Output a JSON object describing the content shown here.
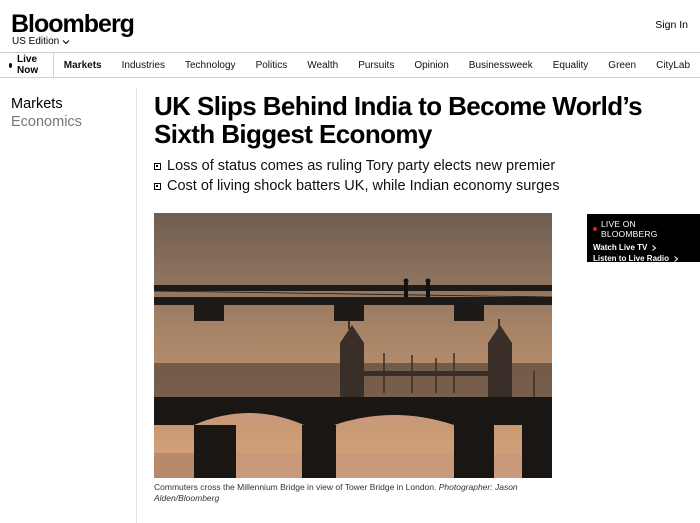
{
  "header": {
    "logo": "Bloomberg",
    "edition": "US Edition",
    "signin": "Sign In"
  },
  "nav": {
    "live": "Live Now",
    "items": [
      {
        "label": "Markets",
        "active": true
      },
      {
        "label": "Industries"
      },
      {
        "label": "Technology"
      },
      {
        "label": "Politics"
      },
      {
        "label": "Wealth"
      },
      {
        "label": "Pursuits"
      },
      {
        "label": "Opinion"
      },
      {
        "label": "Businessweek"
      },
      {
        "label": "Equality"
      },
      {
        "label": "Green"
      },
      {
        "label": "CityLab"
      }
    ]
  },
  "article": {
    "section": "Markets",
    "subsection": "Economics",
    "headline": "UK Slips Behind India to Become World’s Sixth Biggest Economy",
    "bullets": [
      "Loss of status comes as ruling Tory party elects new premier",
      "Cost of living shock batters UK, while Indian economy surges"
    ],
    "caption": "Commuters cross the Millennium Bridge in view of Tower Bridge in London.",
    "caption_credit": "Photographer: Jason Alden/Bloomberg"
  },
  "live_box": {
    "title": "LIVE ON BLOOMBERG",
    "tv": "Watch Live TV",
    "radio": "Listen to Live Radio",
    "dot_color": "#e02020"
  },
  "colors": {
    "brand": "#000000",
    "sky_top": "#6f5e52",
    "sky_bottom": "#d9a57a",
    "water": "#c99a7a"
  }
}
